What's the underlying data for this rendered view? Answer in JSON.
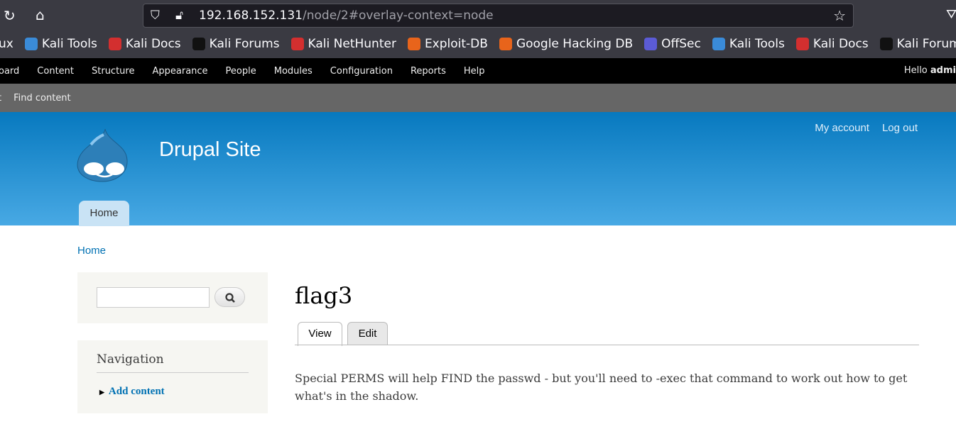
{
  "browser": {
    "url_host": "192.168.152.131",
    "url_path": "/node/2#overlay-context=node",
    "bookmarks": [
      {
        "label": "Kali Tools",
        "color": "#3a8bd8"
      },
      {
        "label": "Kali Docs",
        "color": "#d32f2f"
      },
      {
        "label": "Kali Forums",
        "color": "#111111"
      },
      {
        "label": "Kali NetHunter",
        "color": "#d32f2f"
      },
      {
        "label": "Exploit-DB",
        "color": "#e8641b"
      },
      {
        "label": "Google Hacking DB",
        "color": "#e8641b"
      },
      {
        "label": "OffSec",
        "color": "#5b5bd6"
      },
      {
        "label": "Kali Tools",
        "color": "#3a8bd8"
      },
      {
        "label": "Kali Docs",
        "color": "#d32f2f"
      },
      {
        "label": "Kali Forums",
        "color": "#111111"
      }
    ],
    "bookmark_partial": "ux"
  },
  "admin": {
    "menu": [
      "oard",
      "Content",
      "Structure",
      "Appearance",
      "People",
      "Modules",
      "Configuration",
      "Reports",
      "Help"
    ],
    "hello": "Hello",
    "user": "admi"
  },
  "shortcuts": {
    "partial": "t",
    "find_content": "Find content"
  },
  "header": {
    "site_name": "Drupal Site",
    "my_account": "My account",
    "log_out": "Log out",
    "home_tab": "Home"
  },
  "breadcrumb": "Home",
  "sidebar": {
    "navigation_title": "Navigation",
    "add_content": "Add content"
  },
  "node": {
    "title": "flag3",
    "tabs": [
      "View",
      "Edit"
    ],
    "body": "Special PERMS will help FIND the passwd - but you'll need to -exec that command to work out how to get what's in the shadow."
  },
  "colors": {
    "header_top": "#0779bf",
    "header_bottom": "#48a9e4",
    "link": "#0071b3"
  }
}
